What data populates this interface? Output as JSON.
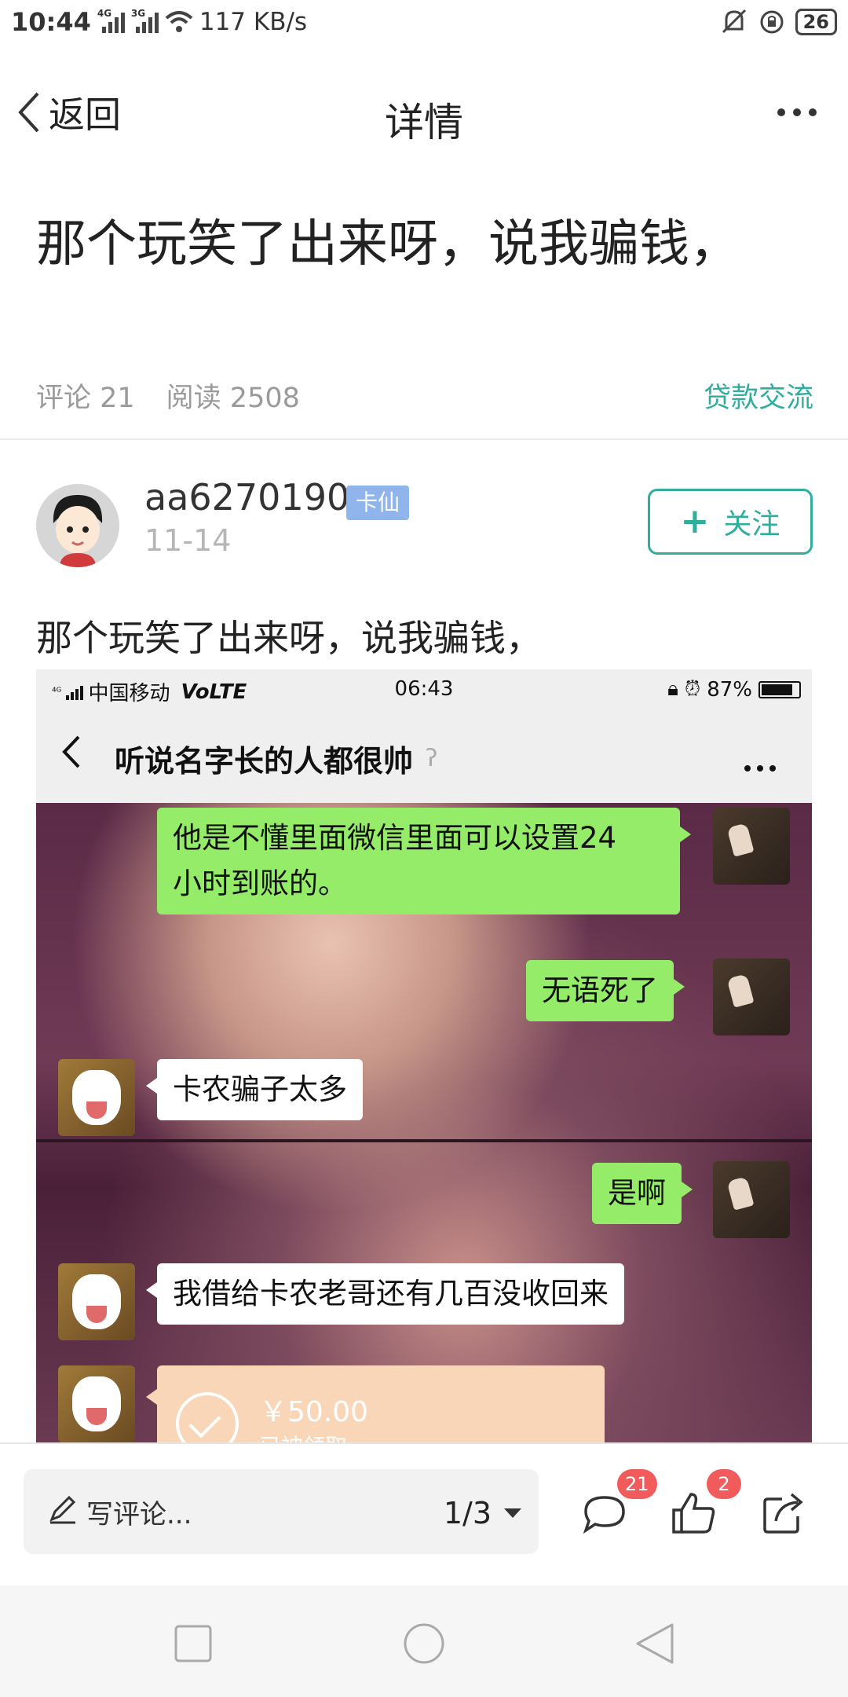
{
  "status_bar": {
    "time": "10:44",
    "net1": "4G",
    "net2": "3G",
    "speed": "117 KB/s",
    "battery": "26"
  },
  "nav": {
    "back_label": "返回",
    "title": "详情"
  },
  "post": {
    "title": "那个玩笑了出来呀，说我骗钱，",
    "comments_label": "评论 21",
    "reads_label": "阅读 2508",
    "category": "贷款交流",
    "body": "那个玩笑了出来呀，说我骗钱，"
  },
  "author": {
    "name": "aa6270190",
    "badge": "卡仙",
    "date": "11-14",
    "follow_label": "关注"
  },
  "screenshot": {
    "carrier": "中国移动",
    "volte": "VoLTE",
    "time": "06:43",
    "battery": "87%",
    "chat_title": "听说名字长的人都很帅",
    "messages": [
      {
        "side": "out",
        "text": "他是不懂里面微信里面可以设置24\n小时到账的。"
      },
      {
        "side": "out",
        "text": "无语死了"
      },
      {
        "side": "in",
        "text": "卡农骗子太多"
      },
      {
        "side": "out",
        "text": "是啊"
      },
      {
        "side": "in",
        "text": "我借给卡农老哥还有几百没收回来"
      }
    ],
    "transfer_amount": "￥50.00",
    "transfer_status": "已被领取"
  },
  "toolbar": {
    "comment_placeholder": "写评论...",
    "page_indicator": "1/3",
    "comment_count": "21",
    "like_count": "2"
  },
  "colors": {
    "accent": "#2fae9c",
    "badge_bg": "#8fb5ec",
    "wechat_green": "#95ec69",
    "notify_red": "#f25b5b"
  }
}
